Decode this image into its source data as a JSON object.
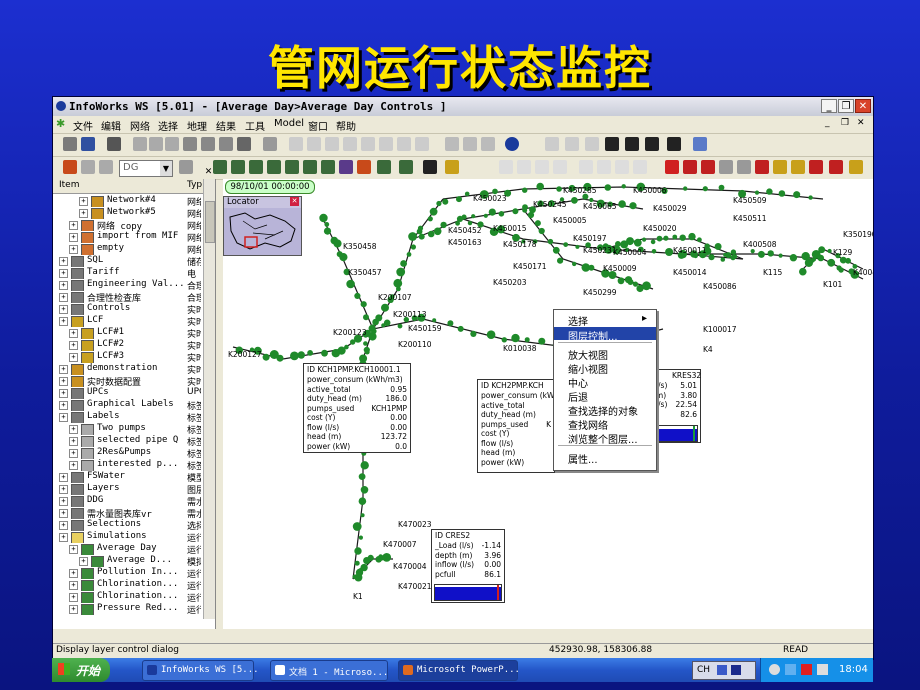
{
  "slide": {
    "title": "管网运行状态监控"
  },
  "window": {
    "title": "InfoWorks WS [5.01] - [Average Day>Average Day Controls ]",
    "buttons": [
      "_",
      "❐",
      "✕"
    ]
  },
  "menu": {
    "items": [
      "文件",
      "编辑",
      "网络",
      "选择",
      "地理",
      "结果",
      "工具",
      "Model",
      "窗口",
      "帮助"
    ]
  },
  "toolbar": {
    "combo_value": "DG"
  },
  "panel": {
    "headers": {
      "item": "Item",
      "type": "Typ"
    },
    "rows": [
      {
        "label": "Network#4",
        "type": "网络",
        "indent": 2
      },
      {
        "label": "Network#5",
        "type": "网络",
        "indent": 2
      },
      {
        "label": "网络 copy",
        "type": "网络",
        "indent": 1
      },
      {
        "label": "import from MIF",
        "type": "网络",
        "indent": 1
      },
      {
        "label": "empty",
        "type": "网络",
        "indent": 1
      },
      {
        "label": "SQL",
        "type": "储存",
        "indent": 0
      },
      {
        "label": "Tariff",
        "type": "电",
        "indent": 0
      },
      {
        "label": "Engineering Val...",
        "type": "合理",
        "indent": 0
      },
      {
        "label": "合理性检查库",
        "type": "合理",
        "indent": 0
      },
      {
        "label": "Controls",
        "type": "实时",
        "indent": 0
      },
      {
        "label": "LCF",
        "type": "实时",
        "indent": 0
      },
      {
        "label": "LCF#1",
        "type": "实时",
        "indent": 1
      },
      {
        "label": "LCF#2",
        "type": "实时",
        "indent": 1
      },
      {
        "label": "LCF#3",
        "type": "实时",
        "indent": 1
      },
      {
        "label": "demonstration",
        "type": "实时",
        "indent": 0
      },
      {
        "label": "实时数据配置",
        "type": "实时",
        "indent": 0
      },
      {
        "label": "UPCs",
        "type": "UPC",
        "indent": 0
      },
      {
        "label": "Graphical Labels",
        "type": "标签",
        "indent": 0
      },
      {
        "label": "Labels",
        "type": "标签",
        "indent": 0
      },
      {
        "label": "Two pumps",
        "type": "标签",
        "indent": 1
      },
      {
        "label": "selected pipe Q",
        "type": "标签",
        "indent": 1
      },
      {
        "label": "2Res&Pumps",
        "type": "标签",
        "indent": 1
      },
      {
        "label": "interested p...",
        "type": "标签",
        "indent": 1
      },
      {
        "label": "FSWater",
        "type": "模型",
        "indent": 0
      },
      {
        "label": "Layers",
        "type": "图层",
        "indent": 0
      },
      {
        "label": "DDG",
        "type": "需水",
        "indent": 0
      },
      {
        "label": "需水量图表库vr",
        "type": "需水",
        "indent": 0
      },
      {
        "label": "Selections",
        "type": "选择",
        "indent": 0
      },
      {
        "label": "Simulations",
        "type": "运行",
        "indent": 0
      },
      {
        "label": "Average Day",
        "type": "运行",
        "indent": 1
      },
      {
        "label": "Average D...",
        "type": "模拟",
        "indent": 2
      },
      {
        "label": "Pollution In...",
        "type": "运行",
        "indent": 1
      },
      {
        "label": "Chlorination...",
        "type": "运行",
        "indent": 1
      },
      {
        "label": "Chlorination...",
        "type": "运行",
        "indent": 1
      },
      {
        "label": "Pressure Red...",
        "type": "运行",
        "indent": 1
      }
    ]
  },
  "map": {
    "timestamp": "98/10/01 00:00:00",
    "locator_title": "Locator",
    "node_labels": [
      "K450285",
      "K450006",
      "K450509",
      "K450245",
      "K450065",
      "K450029",
      "K450511",
      "K450023",
      "K450015",
      "K450005",
      "K450020",
      "K450452",
      "K450197",
      "K450163",
      "K450178",
      "K450231",
      "K450004",
      "K450011",
      "K400508",
      "K450171",
      "K450009",
      "K450014",
      "K115",
      "K129",
      "K450203",
      "K450086",
      "K101",
      "K400474",
      "K450299",
      "K350458",
      "K350457",
      "K200107",
      "K200113",
      "K200123",
      "K450159",
      "K200110",
      "K010038",
      "K200127",
      "K470023",
      "K470007",
      "K470012",
      "K470004",
      "K470021",
      "K1",
      "K350190",
      "K10001",
      "K100017",
      "K4"
    ]
  },
  "context_menu": {
    "items": [
      "选择",
      "图层控制...",
      "放大视图",
      "缩小视图",
      "中心",
      "后退",
      "查找选择的对象",
      "查找网络",
      "浏览整个图层...",
      "属性..."
    ],
    "selected": "图层控制..."
  },
  "popups": {
    "kch1": {
      "title": "ID   KCH1PMP.KCH10001.1",
      "rows": [
        {
          "k": "power_consum (kWh/m3)",
          "v": ""
        },
        {
          "k": "active_total",
          "v": "0.95"
        },
        {
          "k": "duty_head (m)",
          "v": "186.0"
        },
        {
          "k": "pumps_used",
          "v": "KCH1PMP"
        },
        {
          "k": "cost (Y)",
          "v": "0.00"
        },
        {
          "k": "flow (l/s)",
          "v": "0.00"
        },
        {
          "k": "head (m)",
          "v": "123.72"
        },
        {
          "k": "power (kW)",
          "v": "0.0"
        }
      ]
    },
    "kch2": {
      "title": "ID   KCH2PMP.KCH",
      "rows": [
        {
          "k": "power_consum (kWh/m3)",
          "v": ""
        },
        {
          "k": "active_total",
          "v": ""
        },
        {
          "k": "duty_head (m)",
          "v": ""
        },
        {
          "k": "pumps_used",
          "v": "K"
        },
        {
          "k": "cost (Y)",
          "v": ""
        },
        {
          "k": "flow (l/s)",
          "v": ""
        },
        {
          "k": "head (m)",
          "v": ""
        },
        {
          "k": "power (kW)",
          "v": ""
        }
      ]
    },
    "kres32": {
      "title": "KRES32",
      "rows": [
        {
          "k": "(l/s)",
          "v": "5.01"
        },
        {
          "k": "(m)",
          "v": "3.80"
        },
        {
          "k": "(l/s)",
          "v": "22.54"
        },
        {
          "k": "",
          "v": "82.6"
        }
      ],
      "fill_level": 0.826
    },
    "cres2": {
      "title": "ID       CRES2",
      "rows": [
        {
          "k": "_Load (l/s)",
          "v": "-1.14"
        },
        {
          "k": "depth (m)",
          "v": "3.96"
        },
        {
          "k": "inflow (l/s)",
          "v": "0.00"
        },
        {
          "k": "pcfull",
          "v": "86.1"
        }
      ],
      "fill_level": 0.861
    }
  },
  "status": {
    "hint": "Display layer control dialog",
    "coords": "452930.98, 158306.88",
    "mode": "READ"
  },
  "taskbar": {
    "start": "开始",
    "tasks": [
      "InfoWorks WS [5...",
      "文档 1 - Microso...",
      "Microsoft PowerP..."
    ],
    "ime": "CH",
    "clock": "18:04"
  }
}
